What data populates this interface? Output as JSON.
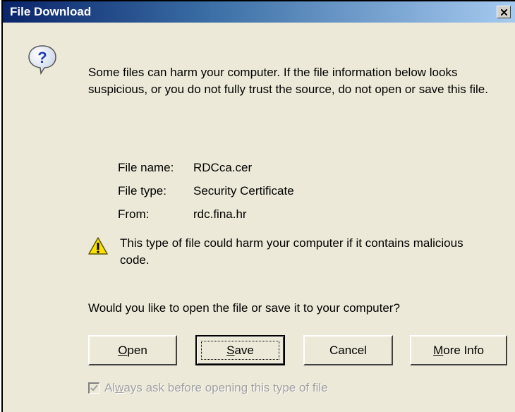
{
  "window": {
    "title": "File Download",
    "close_symbol": "×"
  },
  "icons": {
    "question": "question-bubble-icon",
    "warning": "warning-triangle-icon"
  },
  "message": "Some files can harm your computer. If the file information below looks suspicious, or you do not fully trust the source, do not open or save this file.",
  "file_info": {
    "name_label": "File name:",
    "name_value": "RDCca.cer",
    "type_label": "File type:",
    "type_value": "Security Certificate",
    "from_label": "From:",
    "from_value": "rdc.fina.hr"
  },
  "warning_text": "This type of file could harm your computer if it contains malicious code.",
  "question": "Would you like to open the file or save it to your computer?",
  "buttons": {
    "open": {
      "mnemonic": "O",
      "rest": "pen"
    },
    "save": {
      "mnemonic": "S",
      "rest": "ave"
    },
    "cancel": "Cancel",
    "more_info": {
      "mnemonic": "M",
      "rest": "ore Info"
    }
  },
  "checkbox": {
    "checked": true,
    "label_pre": "Al",
    "label_mnemonic": "w",
    "label_post": "ays ask before opening this type of file"
  },
  "colors": {
    "dialog_bg": "#ece9d8",
    "titlebar_start": "#0a246a",
    "titlebar_end": "#a6caf0",
    "disabled_text": "#a0a0a0"
  }
}
